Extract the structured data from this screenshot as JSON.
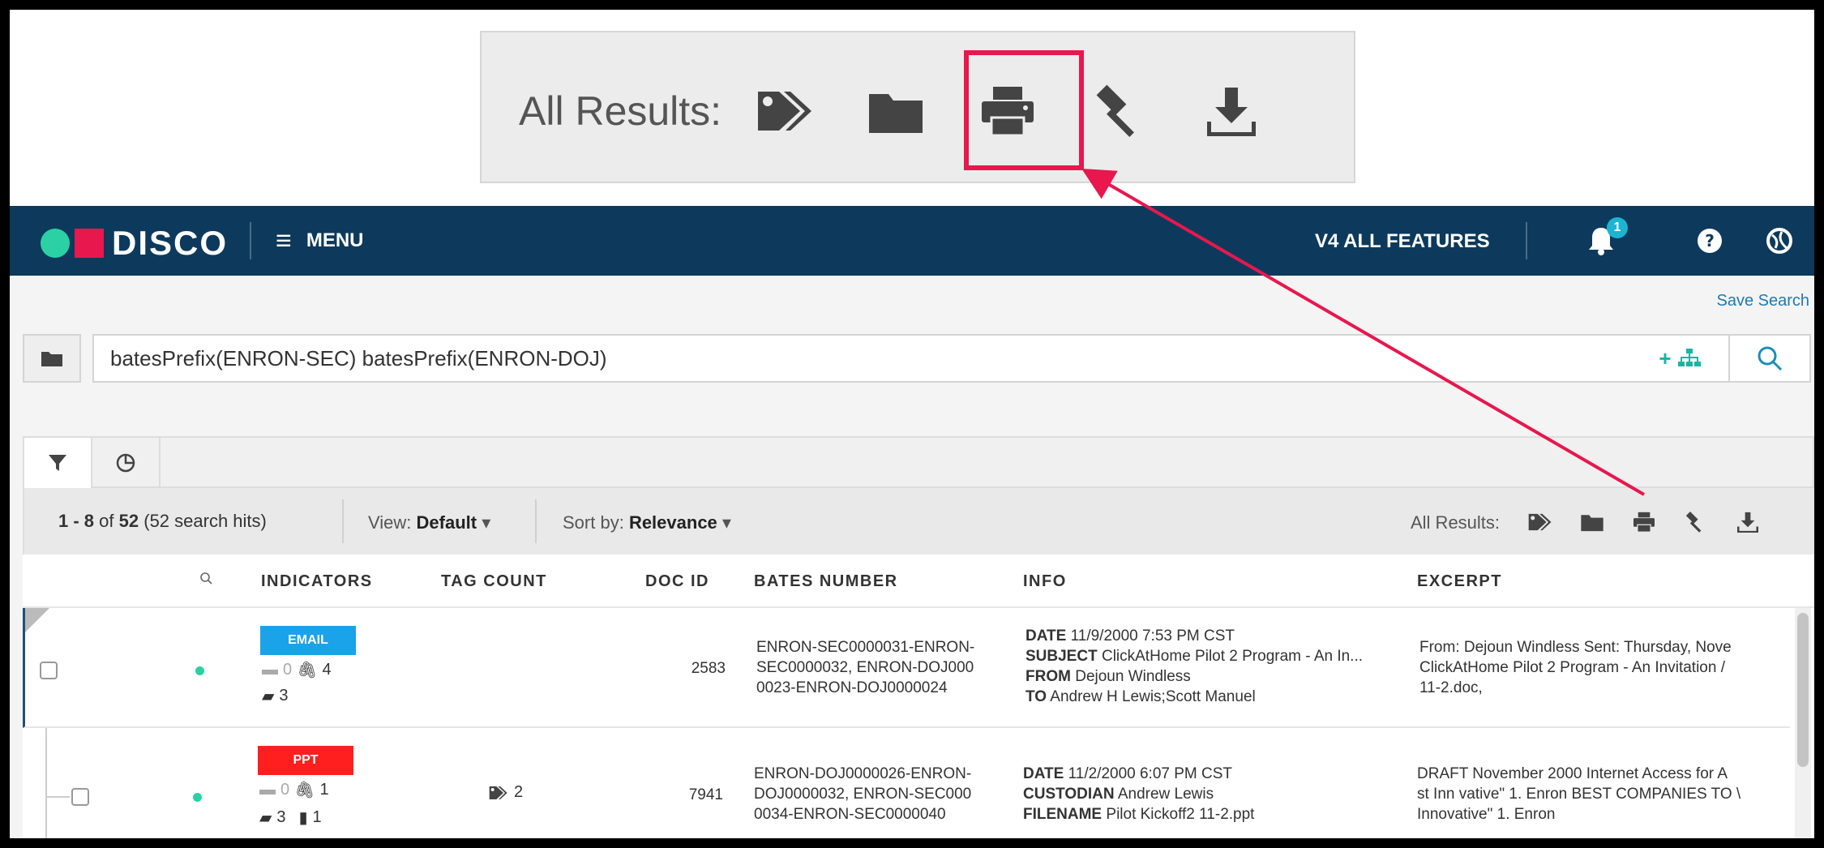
{
  "callout": {
    "label": "All Results:",
    "icons": [
      "tags-icon",
      "folder-icon",
      "print-icon",
      "gavel-icon",
      "download-icon"
    ],
    "highlight_color": "#e8174d"
  },
  "header": {
    "brand": "DISCO",
    "menu_label": "MENU",
    "features_label": "V4 ALL FEATURES",
    "notification_count": "1",
    "colors": {
      "bar": "#0d3a5c",
      "accent_green": "#2bd1a5",
      "accent_red": "#e8174d"
    }
  },
  "search": {
    "save_label": "Save Search",
    "query": "batesPrefix(ENRON-SEC) batesPrefix(ENRON-DOJ)",
    "add_label": "+"
  },
  "toolbar": {
    "range": "1 - 8",
    "of": "of",
    "total": "52",
    "hits": "(52 search hits)",
    "view_label": "View:",
    "view_value": "Default",
    "sort_label": "Sort by:",
    "sort_value": "Relevance",
    "all_results_label": "All Results:"
  },
  "columns": {
    "indicators": "INDICATORS",
    "tag_count": "TAG COUNT",
    "doc_id": "DOC ID",
    "bates": "BATES NUMBER",
    "info": "INFO",
    "excerpt": "EXCERPT"
  },
  "rows": [
    {
      "type": "EMAIL",
      "type_color": "#1aa3e8",
      "comments": "0",
      "attachments": "4",
      "folders": "3",
      "tag_count": "",
      "doc_id": "2583",
      "bates": [
        "ENRON-SEC0000031-ENRON-",
        "SEC0000032, ENRON-DOJ000",
        "0023-ENRON-DOJ0000024"
      ],
      "info": [
        {
          "label": "DATE",
          "value": "11/9/2000 7:53 PM CST"
        },
        {
          "label": "SUBJECT",
          "value": "ClickAtHome Pilot 2 Program - An In..."
        },
        {
          "label": "FROM",
          "value": "Dejoun Windless"
        },
        {
          "label": "TO",
          "value": "Andrew H Lewis;Scott Manuel"
        }
      ],
      "excerpt": [
        "From: Dejoun Windless Sent: Thursday, Nove",
        "ClickAtHome Pilot 2 Program - An Invitation /",
        "11-2.doc,"
      ]
    },
    {
      "type": "PPT",
      "type_color": "#ff1f1f",
      "comments": "0",
      "attachments": "1",
      "folders": "3",
      "docs": "1",
      "tag_count": "2",
      "doc_id": "7941",
      "bates": [
        "ENRON-DOJ0000026-ENRON-",
        "DOJ0000032, ENRON-SEC000",
        "0034-ENRON-SEC0000040"
      ],
      "info": [
        {
          "label": "DATE",
          "value": "11/2/2000 6:07 PM CST"
        },
        {
          "label": "CUSTODIAN",
          "value": "Andrew Lewis"
        },
        {
          "label": "FILENAME",
          "value": "Pilot Kickoff2 11-2.ppt"
        }
      ],
      "excerpt": [
        "DRAFT November 2000 Internet Access for A",
        "st Inn vative\" 1. Enron BEST COMPANIES TO \\",
        "Innovative\" 1. Enron"
      ]
    }
  ]
}
